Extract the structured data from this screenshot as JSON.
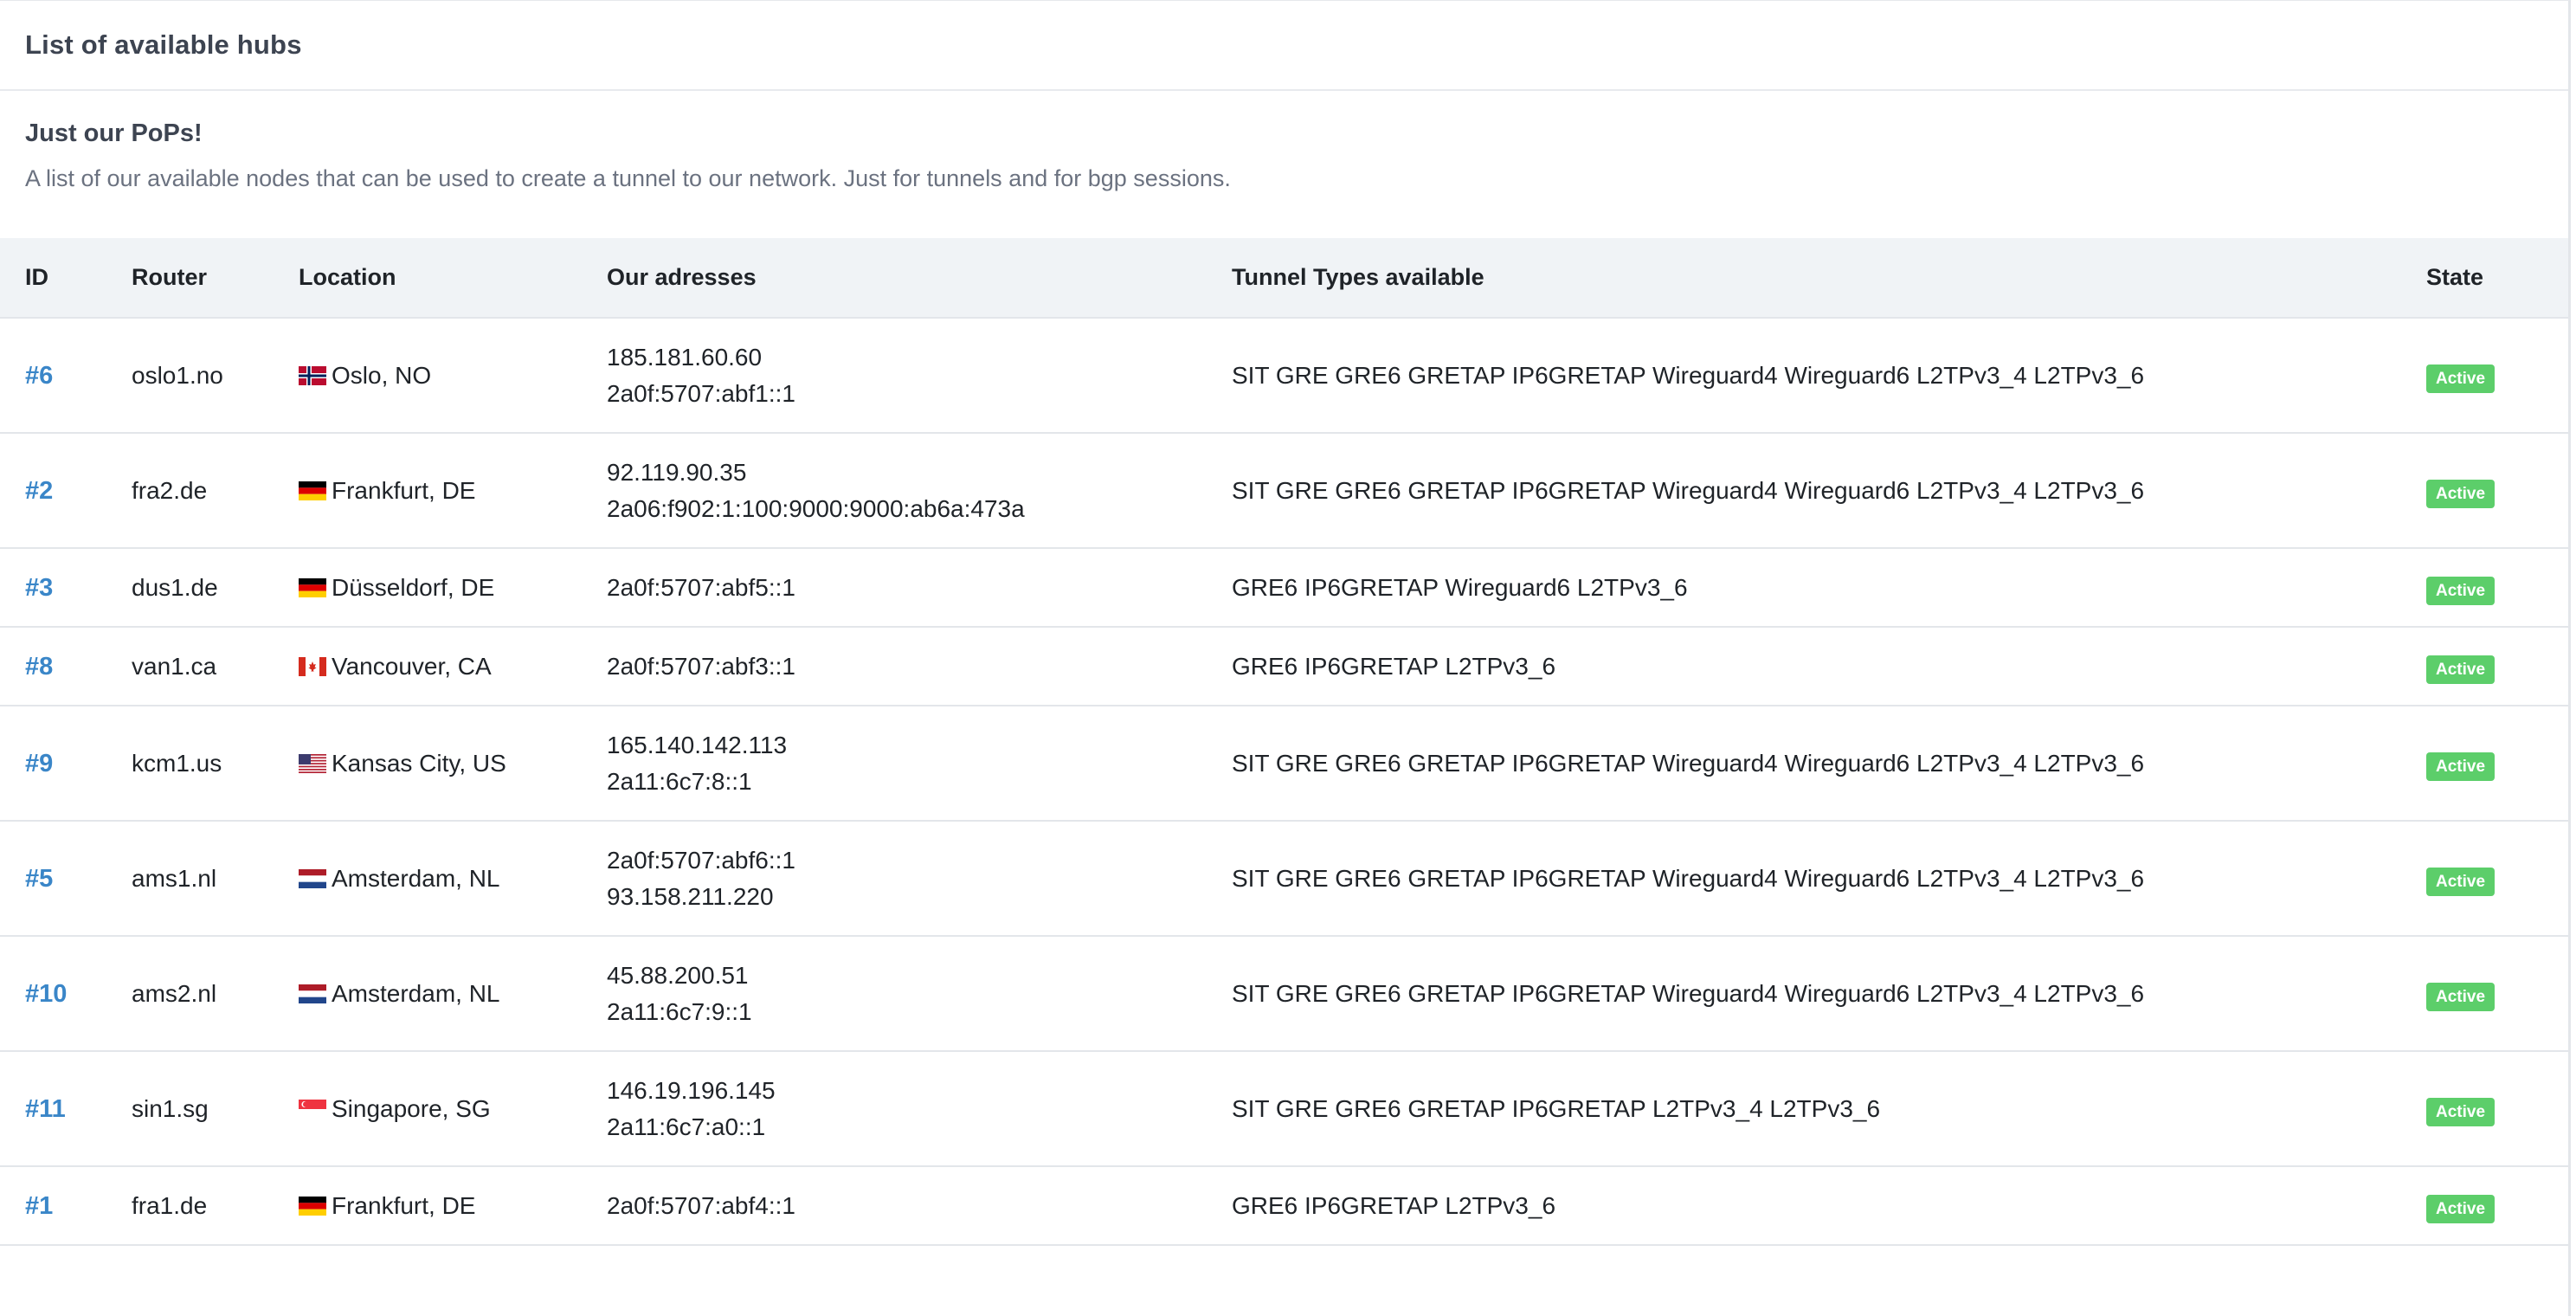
{
  "header": {
    "title": "List of available hubs"
  },
  "intro": {
    "heading": "Just our PoPs!",
    "text": "A list of our available nodes that can be used to create a tunnel to our network. Just for tunnels and for bgp sessions."
  },
  "table": {
    "columns": [
      "ID",
      "Router",
      "Location",
      "Our adresses",
      "Tunnel Types available",
      "State"
    ],
    "rows": [
      {
        "id": "#6",
        "router": "oslo1.no",
        "flag": "no",
        "flag_icon": "flag-norway-icon",
        "location": "Oslo, NO",
        "addresses": [
          "185.181.60.60",
          "2a0f:5707:abf1::1"
        ],
        "tunnels": "SIT GRE GRE6 GRETAP IP6GRETAP Wireguard4 Wireguard6 L2TPv3_4 L2TPv3_6",
        "state": "Active"
      },
      {
        "id": "#2",
        "router": "fra2.de",
        "flag": "de",
        "flag_icon": "flag-germany-icon",
        "location": "Frankfurt, DE",
        "addresses": [
          "92.119.90.35",
          "2a06:f902:1:100:9000:9000:ab6a:473a"
        ],
        "tunnels": "SIT GRE GRE6 GRETAP IP6GRETAP Wireguard4 Wireguard6 L2TPv3_4 L2TPv3_6",
        "state": "Active"
      },
      {
        "id": "#3",
        "router": "dus1.de",
        "flag": "de",
        "flag_icon": "flag-germany-icon",
        "location": "Düsseldorf, DE",
        "addresses": [
          "2a0f:5707:abf5::1"
        ],
        "tunnels": "GRE6 IP6GRETAP Wireguard6 L2TPv3_6",
        "state": "Active"
      },
      {
        "id": "#8",
        "router": "van1.ca",
        "flag": "ca",
        "flag_icon": "flag-canada-icon",
        "location": "Vancouver, CA",
        "addresses": [
          "2a0f:5707:abf3::1"
        ],
        "tunnels": "GRE6 IP6GRETAP L2TPv3_6",
        "state": "Active"
      },
      {
        "id": "#9",
        "router": "kcm1.us",
        "flag": "us",
        "flag_icon": "flag-usa-icon",
        "location": "Kansas City, US",
        "addresses": [
          "165.140.142.113",
          "2a11:6c7:8::1"
        ],
        "tunnels": "SIT GRE GRE6 GRETAP IP6GRETAP Wireguard4 Wireguard6 L2TPv3_4 L2TPv3_6",
        "state": "Active"
      },
      {
        "id": "#5",
        "router": "ams1.nl",
        "flag": "nl",
        "flag_icon": "flag-netherlands-icon",
        "location": "Amsterdam, NL",
        "addresses": [
          "2a0f:5707:abf6::1",
          "93.158.211.220"
        ],
        "tunnels": "SIT GRE GRE6 GRETAP IP6GRETAP Wireguard4 Wireguard6 L2TPv3_4 L2TPv3_6",
        "state": "Active"
      },
      {
        "id": "#10",
        "router": "ams2.nl",
        "flag": "nl",
        "flag_icon": "flag-netherlands-icon",
        "location": "Amsterdam, NL",
        "addresses": [
          "45.88.200.51",
          "2a11:6c7:9::1"
        ],
        "tunnels": "SIT GRE GRE6 GRETAP IP6GRETAP Wireguard4 Wireguard6 L2TPv3_4 L2TPv3_6",
        "state": "Active"
      },
      {
        "id": "#11",
        "router": "sin1.sg",
        "flag": "sg",
        "flag_icon": "flag-singapore-icon",
        "location": "Singapore, SG",
        "addresses": [
          "146.19.196.145",
          "2a11:6c7:a0::1"
        ],
        "tunnels": "SIT GRE GRE6 GRETAP IP6GRETAP L2TPv3_4 L2TPv3_6",
        "state": "Active"
      },
      {
        "id": "#1",
        "router": "fra1.de",
        "flag": "de",
        "flag_icon": "flag-germany-icon",
        "location": "Frankfurt, DE",
        "addresses": [
          "2a0f:5707:abf4::1"
        ],
        "tunnels": "GRE6 IP6GRETAP L2TPv3_6",
        "state": "Active"
      }
    ]
  },
  "colors": {
    "link": "#3a86c8",
    "badge_active": "#5cce6a",
    "header_row_bg": "#f0f3f6",
    "intro_text": "#6b7280"
  }
}
